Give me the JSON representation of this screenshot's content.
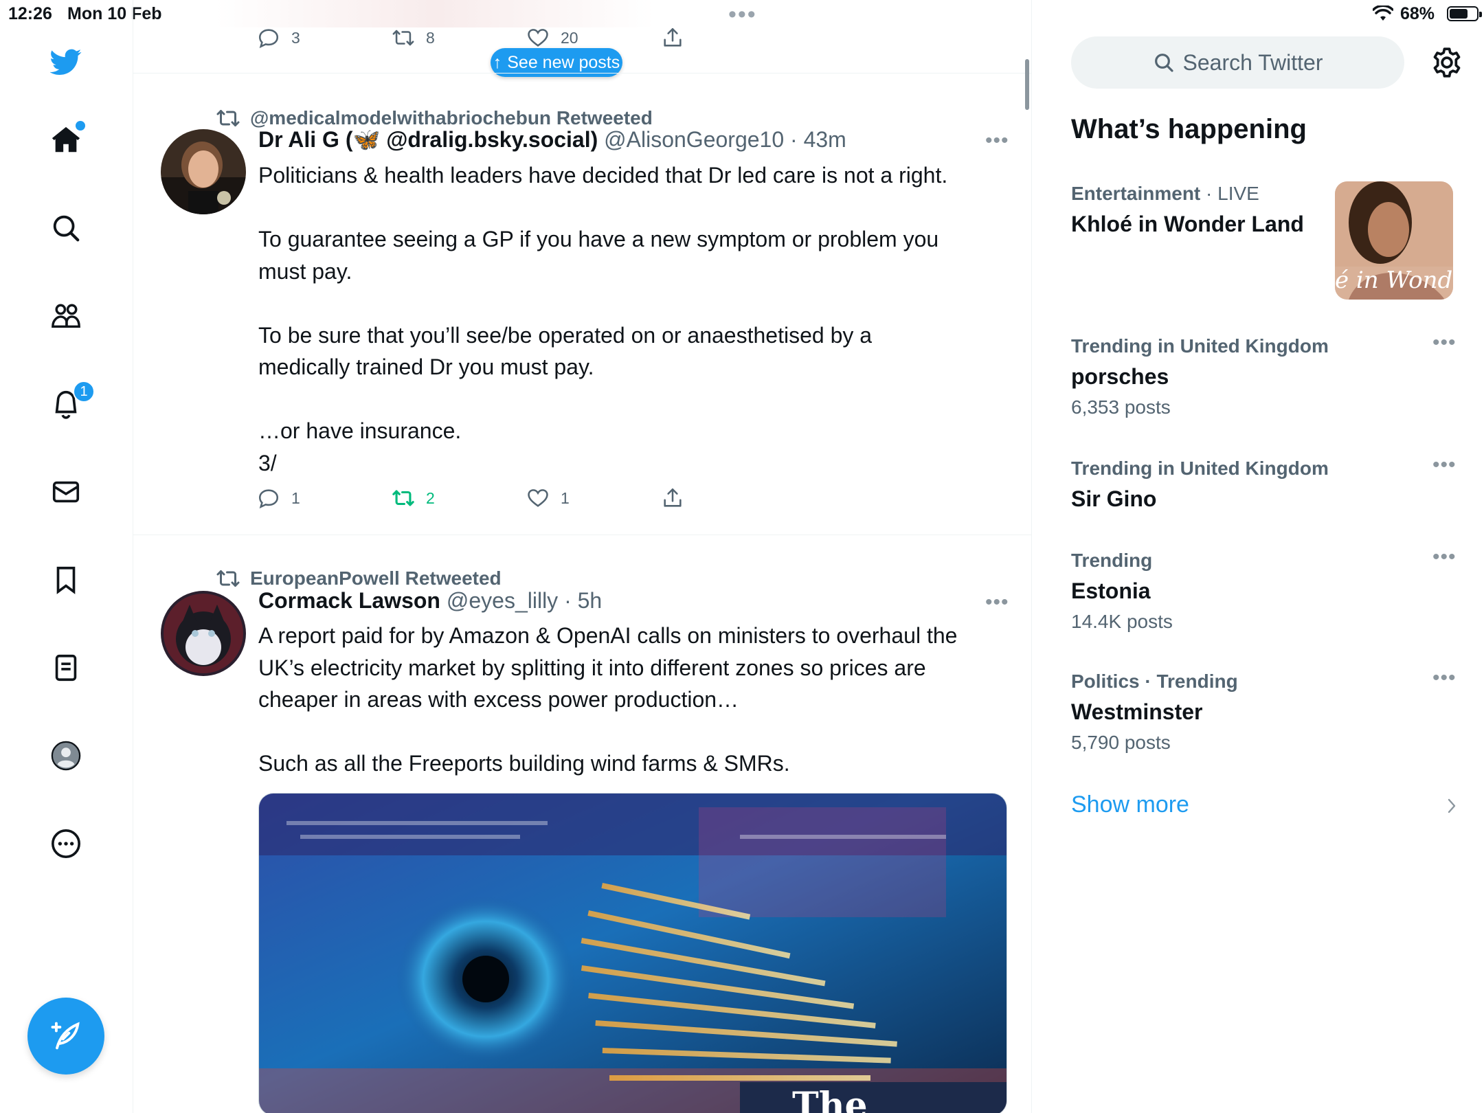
{
  "status_bar": {
    "time": "12:26",
    "date": "Mon 10 Feb",
    "battery_percent": "68%",
    "battery_level": 0.68
  },
  "left_nav": {
    "items": [
      {
        "name": "home",
        "has_dot": true
      },
      {
        "name": "explore"
      },
      {
        "name": "communities"
      },
      {
        "name": "notifications",
        "badge": "1"
      },
      {
        "name": "messages"
      },
      {
        "name": "bookmarks"
      },
      {
        "name": "lists"
      },
      {
        "name": "profile"
      },
      {
        "name": "more"
      }
    ],
    "accent": "#1d9bf0"
  },
  "timeline": {
    "see_new_posts": "See new posts",
    "prev_tweet_actions": {
      "reply": "3",
      "retweet": "8",
      "like": "20"
    },
    "tweets": [
      {
        "retweeted_by": "@medicalmodelwithabriochebun Retweeted",
        "name": "Dr Ali G (🦋 @dralig.bsky.social)",
        "handle": "@AlisonGeorge10",
        "separator": "·",
        "time": "43m",
        "body": "Politicians & health leaders have decided that Dr led care is not a right.\n\nTo guarantee seeing a GP if you have a new symptom or problem you\nmust pay.\n\nTo be sure that you’ll see/be operated on or anaesthetised by a\nmedically trained Dr you must pay.\n\n…or have insurance.\n3/",
        "actions": {
          "reply": "1",
          "retweet": "2",
          "like": "1"
        }
      },
      {
        "retweeted_by": "EuropeanPowell Retweeted",
        "name": "Cormack Lawson",
        "handle": "@eyes_lilly",
        "separator": "·",
        "time": "5h",
        "body": "A report paid for by Amazon & OpenAI calls on ministers to overhaul the\nUK’s electricity market by splitting it into different zones so prices are\ncheaper in areas with excess power production…\n\nSuch as all the Freeports building wind farms & SMRs.",
        "media_caption": "The"
      }
    ]
  },
  "sidebar": {
    "search_placeholder": "Search Twitter",
    "section_title": "What’s happening",
    "trends": [
      {
        "category": "Entertainment",
        "live": "LIVE",
        "title": "Khloé in Wonder Land",
        "image_text": "é in Wonder l"
      },
      {
        "category": "Trending in United Kingdom",
        "title": "porsches",
        "count": "6,353 posts"
      },
      {
        "category": "Trending in United Kingdom",
        "title": "Sir Gino",
        "count": ""
      },
      {
        "category": "Trending",
        "title": "Estonia",
        "count": "14.4K posts"
      },
      {
        "category": "Politics · Trending",
        "title": "Westminster",
        "count": "5,790 posts"
      }
    ],
    "show_more": "Show more",
    "separator": "·"
  }
}
